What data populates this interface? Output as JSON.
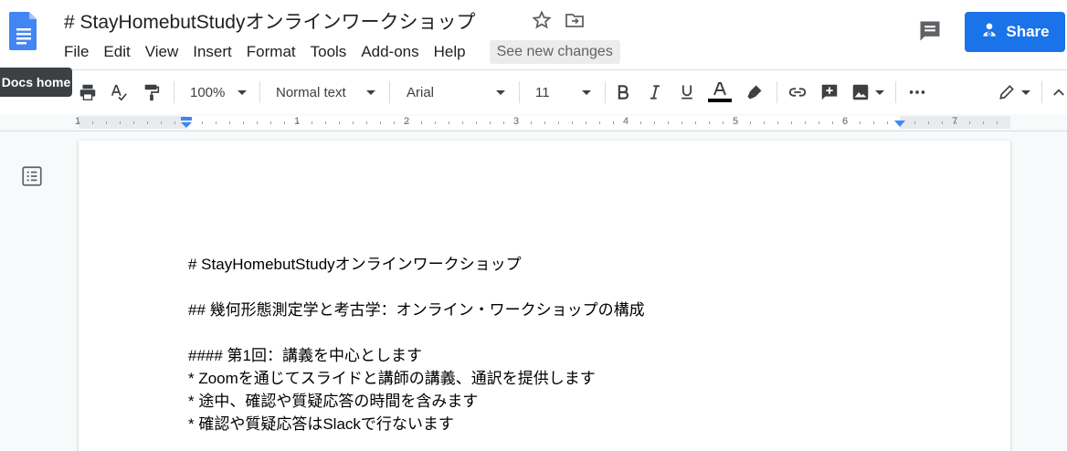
{
  "header": {
    "doc_title": "# StayHomebutStudyオンラインワークショップ",
    "menu": [
      "File",
      "Edit",
      "View",
      "Insert",
      "Format",
      "Tools",
      "Add-ons",
      "Help"
    ],
    "see_new_changes": "See new changes",
    "share_label": "Share",
    "tooltip": "Docs home",
    "icons": [
      "docs-logo",
      "star-icon",
      "move-to-folder-icon",
      "comment-icon",
      "person-add-icon"
    ]
  },
  "toolbar": {
    "zoom": "100%",
    "style": "Normal text",
    "font": "Arial",
    "font_size": "11",
    "icons": [
      "print-icon",
      "spellcheck-icon",
      "paint-format-icon",
      "bold-icon",
      "italic-icon",
      "underline-icon",
      "text-color-icon",
      "highlight-icon",
      "link-icon",
      "add-comment-icon",
      "insert-image-icon",
      "more-icon",
      "editing-mode-icon",
      "collapse-icon"
    ]
  },
  "ruler": {
    "numbers": [
      "1",
      "1",
      "2",
      "3",
      "4",
      "5",
      "6",
      "7"
    ]
  },
  "document": {
    "lines": [
      "# StayHomebutStudyオンラインワークショップ",
      "## 幾何形態測定学と考古学：オンライン・ワークショップの構成",
      "#### 第1回：講義を中心とします",
      "* Zoomを通じてスライドと講師の講義、通訳を提供します",
      "* 途中、確認や質疑応答の時間を含みます",
      "* 確認や質疑応答はSlackで行ないます"
    ]
  },
  "colors": {
    "accent": "#1a73e8",
    "tooltip_bg": "#3c4043"
  }
}
